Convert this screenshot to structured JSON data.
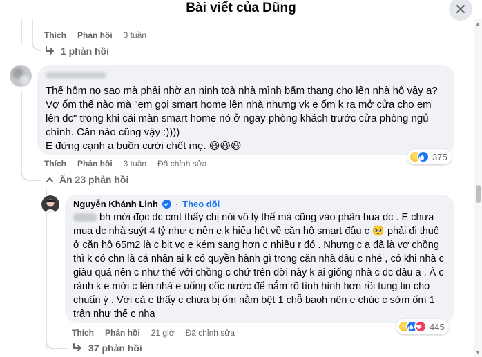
{
  "header": {
    "title": "Bài viết của Dũng",
    "close_icon": "close-icon"
  },
  "top_comment": {
    "actions": {
      "like": "Thích",
      "reply": "Phản hồi",
      "time": "3 tuần"
    },
    "replies_link": "1 phản hồi"
  },
  "comment_a": {
    "text": "Thế hôm nọ sao mà phải nhờ an ninh toà nhà mình bấm thang cho lên nhà hộ vậy a?\nVợ ốm thế nào mà \"em gọi smart home lên nhà nhưng vk e ốm k ra mở cửa cho em lên đc\" trong khi cái màn smart home nó ở ngay phòng khách trước cửa phòng ngủ chính. Căn nào cũng vậy :))))\nE đứng cạnh a buồn cười chết mẹ. 😆😆😆",
    "reaction_count": "375",
    "actions": {
      "like": "Thích",
      "reply": "Phản hồi",
      "time": "3 tuần",
      "edited": "Đã chỉnh sửa"
    },
    "hide_replies": "Ẩn 23 phản hồi"
  },
  "reply_b": {
    "author": "Nguyễn Khánh Linh",
    "follow": "Theo dõi",
    "text_first": "bh mới đọc dc cmt thấy chị nói vô lý thế mà cũng vào phân bua dc . E chưa mua dc nhà suýt 4 tỷ như c nên e k hiểu hết về căn hộ smart đâu c 🥺 phải đi thuê ở căn hộ 65m2 là c bit vc e kém sang hơn c nhiều r đó . Nhưng c ạ đã là vợ chồng thì k có chn là cá nhân ai k có quyền hành gì trong căn nhà đâu c nhé , có khi nhà c giàu quá nên c như thế với chồng c chứ trên đời này k ai giống nhà c dc đâu ạ . À c rảnh k e mời c lên nhà e uống cốc nước để nắm rõ tình hình hơn rồi tung tin cho chuẩn ý . Với cả e thấy c chưa bị ốm nằm bệt 1 chỗ baoh nên e chúc c sớm ốm 1 trận như thế c nha",
    "reaction_count": "445",
    "actions": {
      "like": "Thích",
      "reply": "Phản hồi",
      "time": "21 giờ",
      "edited": "Đã chỉnh sửa"
    },
    "replies_link": "37 phản hồi"
  },
  "colors": {
    "bubble": "#f0f2f5",
    "meta": "#65676b",
    "link": "#1877f2",
    "text": "#050505"
  }
}
